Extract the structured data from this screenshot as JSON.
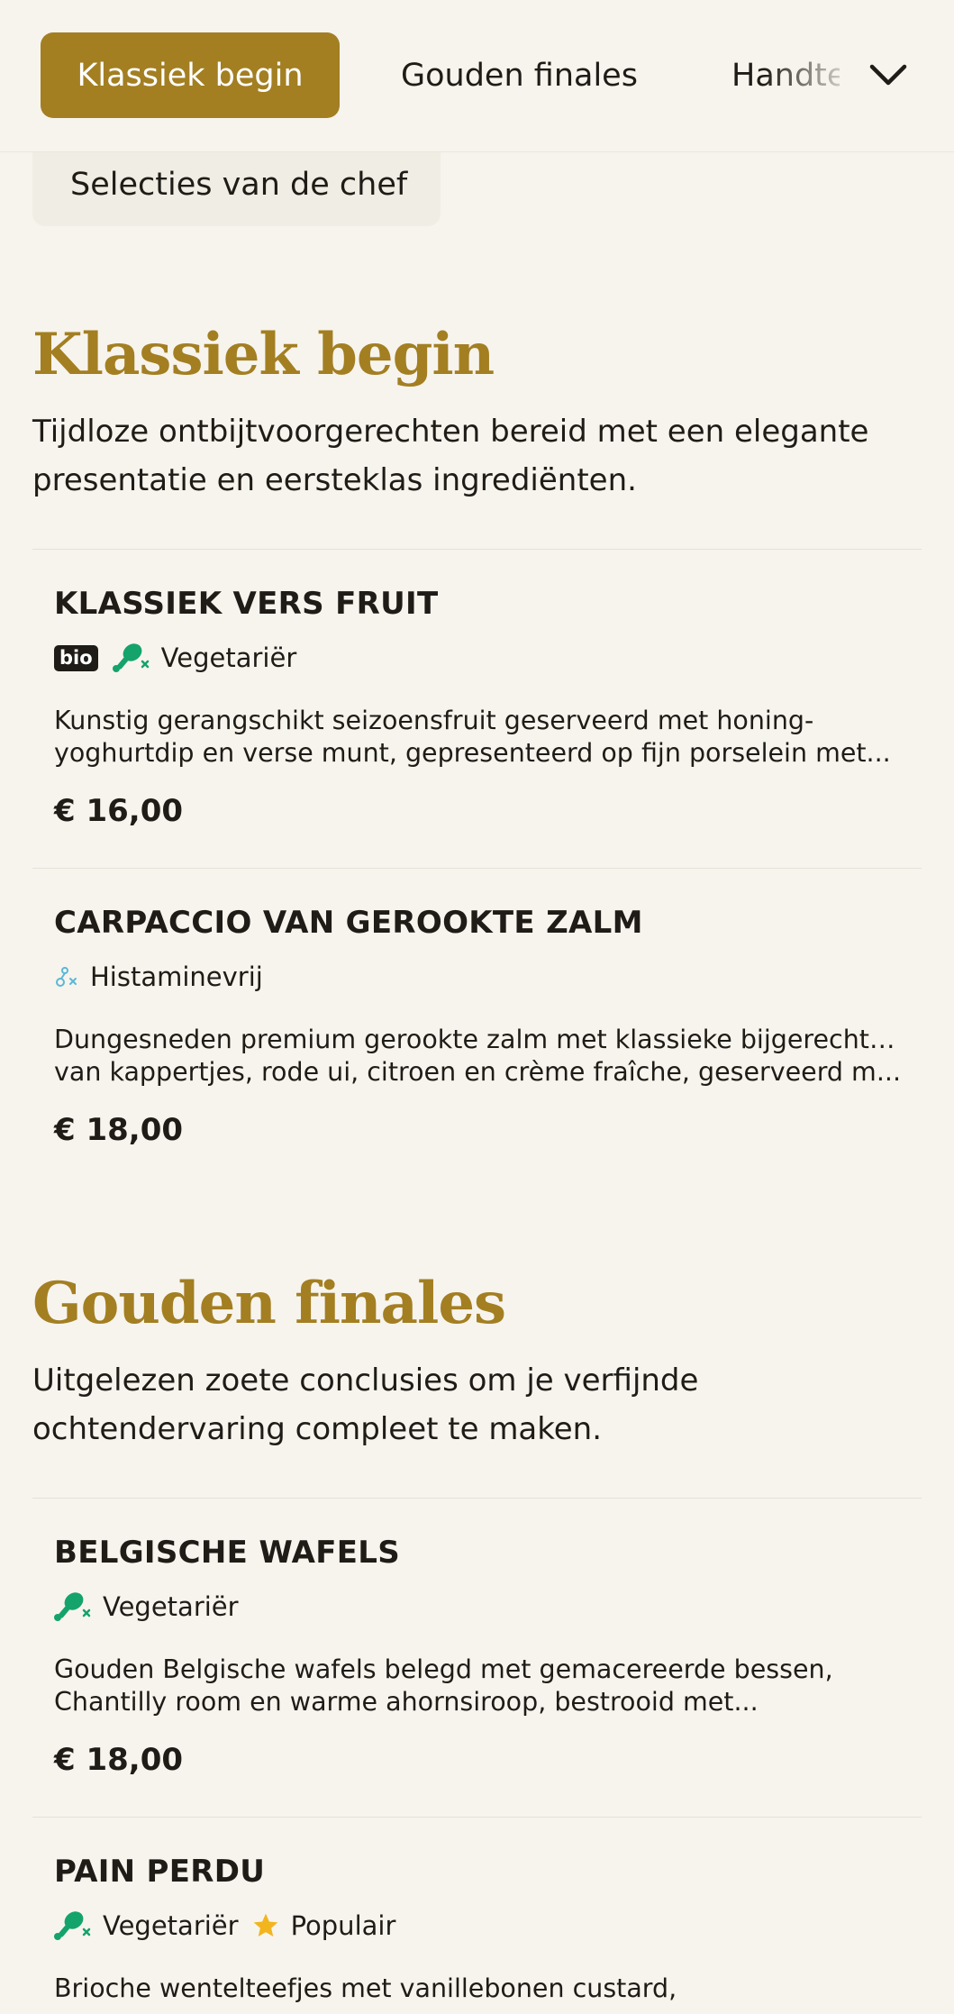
{
  "nav": {
    "tabs": [
      {
        "label": "Klassiek begin",
        "active": true
      },
      {
        "label": "Gouden finales",
        "active": false
      },
      {
        "label": "Handtekening",
        "active": false
      }
    ],
    "chip_label": "Selecties van de chef",
    "expand_icon": "chevron-down-icon"
  },
  "colors": {
    "accent": "#a37f22",
    "background": "#f7f4ee",
    "vegetarian_icon": "#14a36b",
    "histamine_icon": "#5bb8d6",
    "popular_star": "#f2b51d"
  },
  "sections": [
    {
      "title": "Klassiek begin",
      "description_lines": [
        "Tijdloze ontbijtvoorgerechten bereid met een elegante",
        "presentatie en eersteklas ingrediënten."
      ],
      "items": [
        {
          "name": "KLASSIEK VERS FRUIT",
          "badge": "bio",
          "tags": [
            {
              "icon": "vegetarian-drumstick-icon",
              "label": "Vegetariër"
            }
          ],
          "description_lines": [
            "Kunstig gerangschikt seizoensfruit geserveerd met honing-",
            "yoghurtdip en verse munt, gepresenteerd op fijn porselein met..."
          ],
          "price": "€ 16,00"
        },
        {
          "name": "CARPACCIO VAN GEROOKTE ZALM",
          "tags": [
            {
              "icon": "histamine-free-icon",
              "label": "Histaminevrij"
            }
          ],
          "description_lines": [
            "Dungesneden premium gerookte zalm met klassieke bijgerechten",
            "van kappertjes, rode ui, citroen en crème fraîche, geserveerd m..."
          ],
          "price": "€ 18,00"
        }
      ]
    },
    {
      "title": "Gouden finales",
      "description_lines": [
        "Uitgelezen zoete conclusies om je verfijnde",
        "ochtendervaring compleet te maken."
      ],
      "items": [
        {
          "name": "BELGISCHE WAFELS",
          "tags": [
            {
              "icon": "vegetarian-drumstick-icon",
              "label": "Vegetariër"
            }
          ],
          "description_lines": [
            "Gouden Belgische wafels belegd met gemacereerde bessen,",
            "Chantilly room en warme ahornsiroop, bestrooid met..."
          ],
          "price": "€ 18,00"
        },
        {
          "name": "PAIN PERDU",
          "tags": [
            {
              "icon": "vegetarian-drumstick-icon",
              "label": "Vegetariër"
            },
            {
              "icon": "star-icon",
              "label": "Populair"
            }
          ],
          "description_lines": [
            "Brioche wentelteefjes met vanillebonen custard,"
          ]
        }
      ]
    }
  ]
}
